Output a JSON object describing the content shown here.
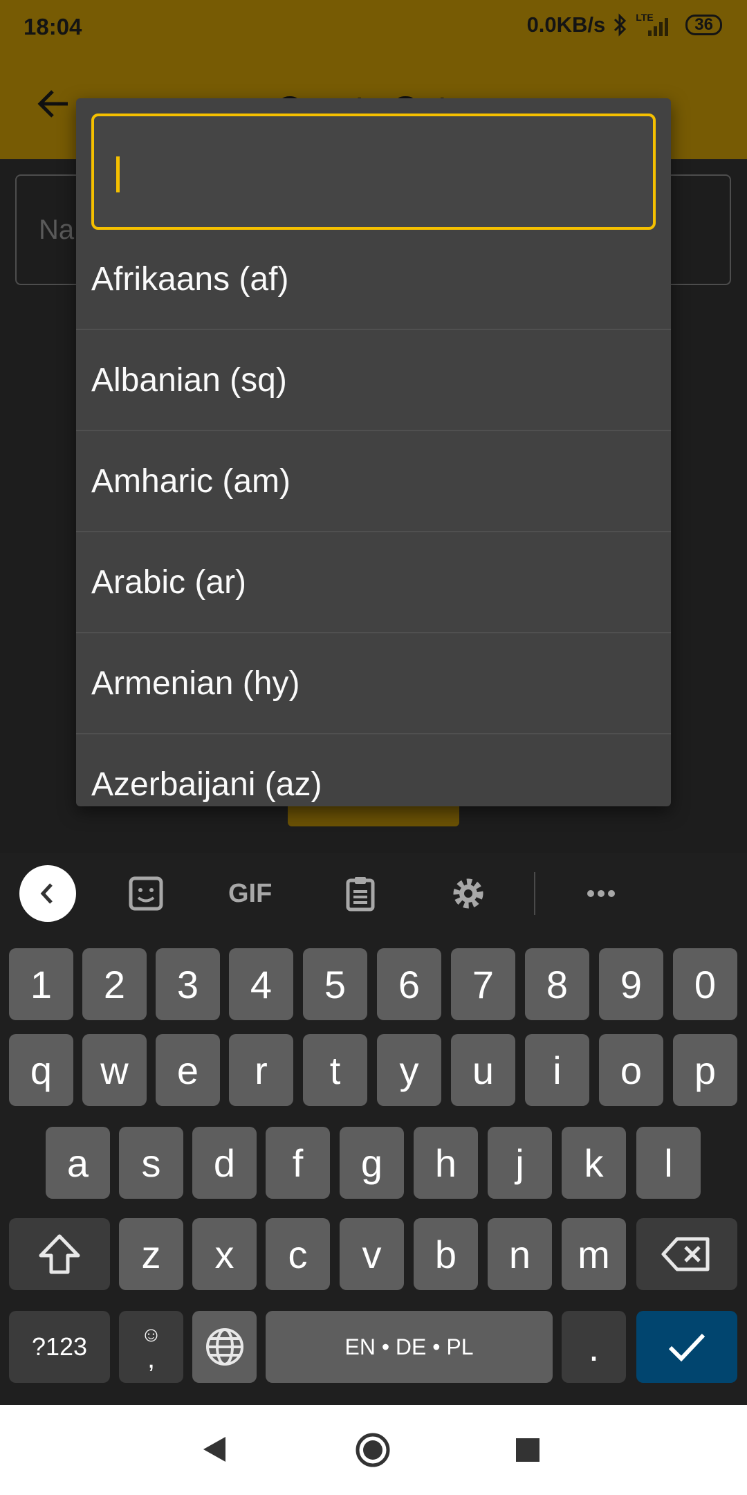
{
  "status_bar": {
    "time": "18:04",
    "net_speed": "0.0KB/s",
    "network_type": "LTE",
    "battery": "36",
    "icons": [
      "bluetooth-icon",
      "signal-icon",
      "battery-icon"
    ]
  },
  "app_bar": {
    "title": "Create Set",
    "back_icon": "arrow-left-icon"
  },
  "form": {
    "name_placeholder": "Na"
  },
  "dropdown": {
    "search_value": "",
    "accent_color": "#f5c000",
    "languages": [
      "Afrikaans (af)",
      "Albanian (sq)",
      "Amharic (am)",
      "Arabic (ar)",
      "Armenian (hy)",
      "Azerbaijani (az)"
    ]
  },
  "keyboard": {
    "toolbar_icons": [
      "chevron-left-icon",
      "sticker-icon",
      "gif-icon",
      "clipboard-icon",
      "gear-icon",
      "more-icon"
    ],
    "gif_label": "GIF",
    "number_row": [
      "1",
      "2",
      "3",
      "4",
      "5",
      "6",
      "7",
      "8",
      "9",
      "0"
    ],
    "row1": [
      "q",
      "w",
      "e",
      "r",
      "t",
      "y",
      "u",
      "i",
      "o",
      "p"
    ],
    "row2": [
      "a",
      "s",
      "d",
      "f",
      "g",
      "h",
      "j",
      "k",
      "l"
    ],
    "row3": [
      "z",
      "x",
      "c",
      "v",
      "b",
      "n",
      "m"
    ],
    "symbols_label": "?123",
    "comma_label": ",",
    "space_label": "EN • DE • PL",
    "period_label": ".",
    "enter_color": "#01456f"
  },
  "nav_bar": {
    "icons": [
      "nav-back-icon",
      "nav-home-icon",
      "nav-recents-icon"
    ]
  }
}
